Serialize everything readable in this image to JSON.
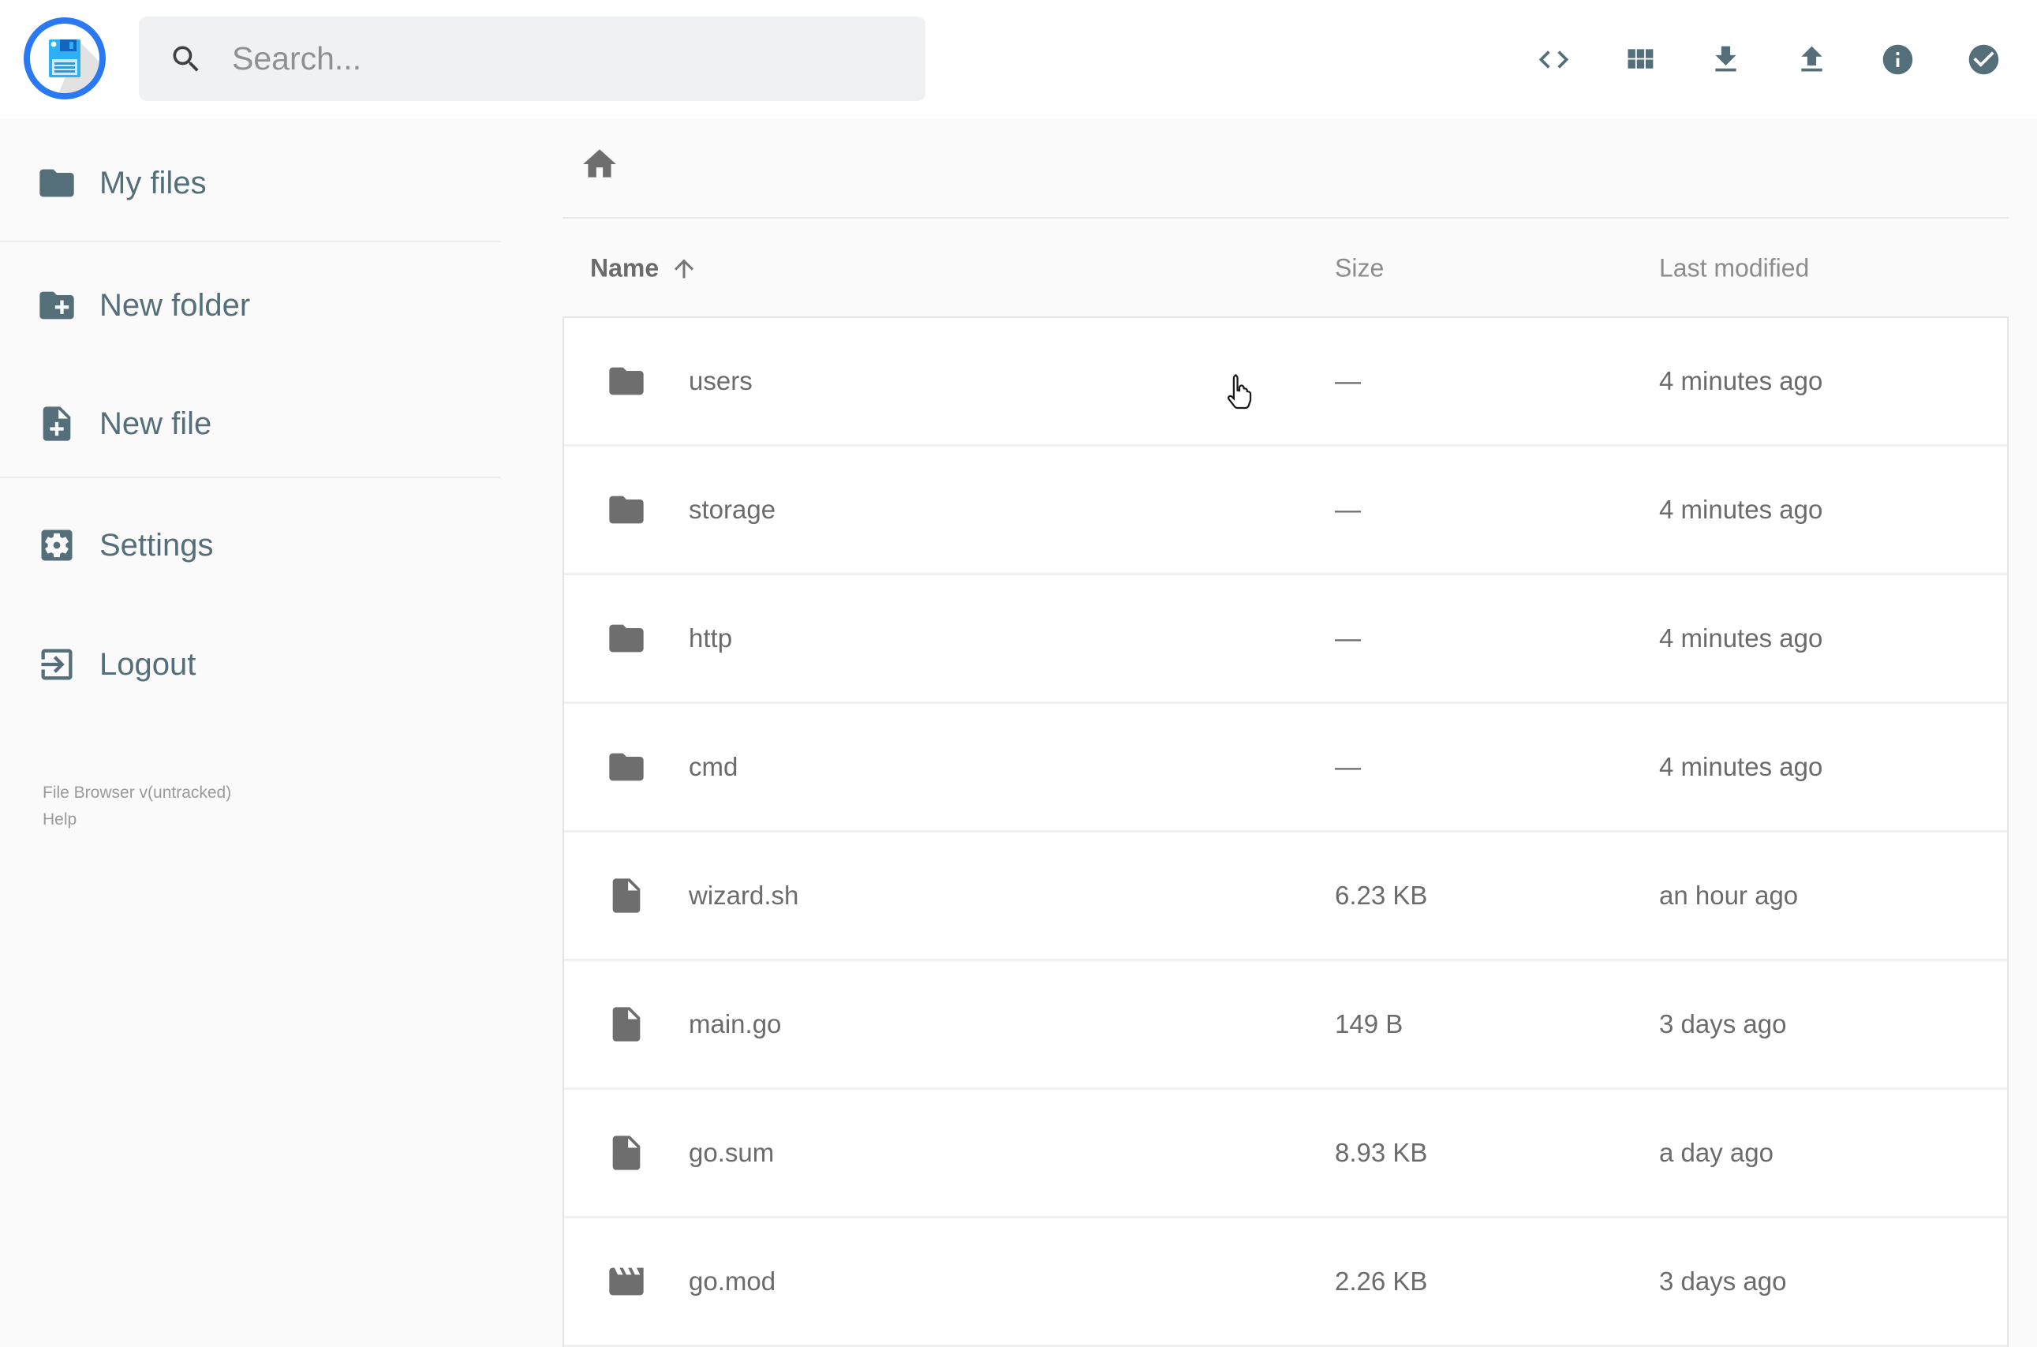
{
  "header": {
    "search": {
      "placeholder": "Search...",
      "icon": "search-icon"
    },
    "actions": [
      {
        "icon": "code-icon"
      },
      {
        "icon": "grid-view-icon"
      },
      {
        "icon": "download-icon"
      },
      {
        "icon": "upload-icon"
      },
      {
        "icon": "info-icon"
      },
      {
        "icon": "check-circle-icon"
      }
    ],
    "logo_icon": "floppy-disk-logo"
  },
  "sidebar": {
    "items": [
      {
        "label": "My files",
        "icon": "folder-icon"
      },
      {
        "label": "New folder",
        "icon": "new-folder-icon"
      },
      {
        "label": "New file",
        "icon": "new-file-icon"
      },
      {
        "label": "Settings",
        "icon": "gear-icon"
      },
      {
        "label": "Logout",
        "icon": "logout-icon"
      }
    ],
    "footer": {
      "version": "File Browser v(untracked)",
      "help": "Help"
    }
  },
  "breadcrumb": {
    "icon": "home-icon"
  },
  "listing": {
    "columns": {
      "name": "Name",
      "size": "Size",
      "modified": "Last modified"
    },
    "sort": {
      "column": "name",
      "direction": "asc",
      "icon": "arrow-up-icon"
    },
    "items": [
      {
        "name": "users",
        "type": "folder",
        "size": "—",
        "modified": "4 minutes ago"
      },
      {
        "name": "storage",
        "type": "folder",
        "size": "—",
        "modified": "4 minutes ago"
      },
      {
        "name": "http",
        "type": "folder",
        "size": "—",
        "modified": "4 minutes ago"
      },
      {
        "name": "cmd",
        "type": "folder",
        "size": "—",
        "modified": "4 minutes ago"
      },
      {
        "name": "wizard.sh",
        "type": "file",
        "size": "6.23 KB",
        "modified": "an hour ago"
      },
      {
        "name": "main.go",
        "type": "file",
        "size": "149 B",
        "modified": "3 days ago"
      },
      {
        "name": "go.sum",
        "type": "file",
        "size": "8.93 KB",
        "modified": "a day ago"
      },
      {
        "name": "go.mod",
        "type": "movie",
        "size": "2.26 KB",
        "modified": "3 days ago"
      }
    ]
  },
  "colors": {
    "accent_blue": "#2a79f3",
    "slate": "#546e7a",
    "icon_gray": "#6e6e6e",
    "text_gray": "#6b6b6b",
    "muted_gray": "#8c8c8c",
    "background": "#fafafa",
    "header_background": "#ffffff",
    "search_background": "#f0f1f2"
  }
}
